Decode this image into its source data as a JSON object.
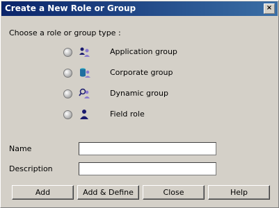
{
  "window": {
    "title": "Create a New Role or Group",
    "close_glyph": "×"
  },
  "prompt": "Choose a role or group type :",
  "options": [
    {
      "label": "Application group",
      "icon": "application-group-icon"
    },
    {
      "label": "Corporate group",
      "icon": "corporate-group-icon"
    },
    {
      "label": "Dynamic group",
      "icon": "dynamic-group-icon"
    },
    {
      "label": "Field role",
      "icon": "field-role-icon"
    }
  ],
  "form": {
    "name_label": "Name",
    "name_value": "",
    "description_label": "Description",
    "description_value": ""
  },
  "buttons": {
    "add": "Add",
    "add_define": "Add & Define",
    "close": "Close",
    "help": "Help"
  },
  "colors": {
    "titlebar_start": "#0a246a",
    "titlebar_end": "#3a6ea5",
    "dialog_bg": "#d4d0c8",
    "icon_navy": "#1a1a6e",
    "icon_purple": "#8a7ad0"
  }
}
